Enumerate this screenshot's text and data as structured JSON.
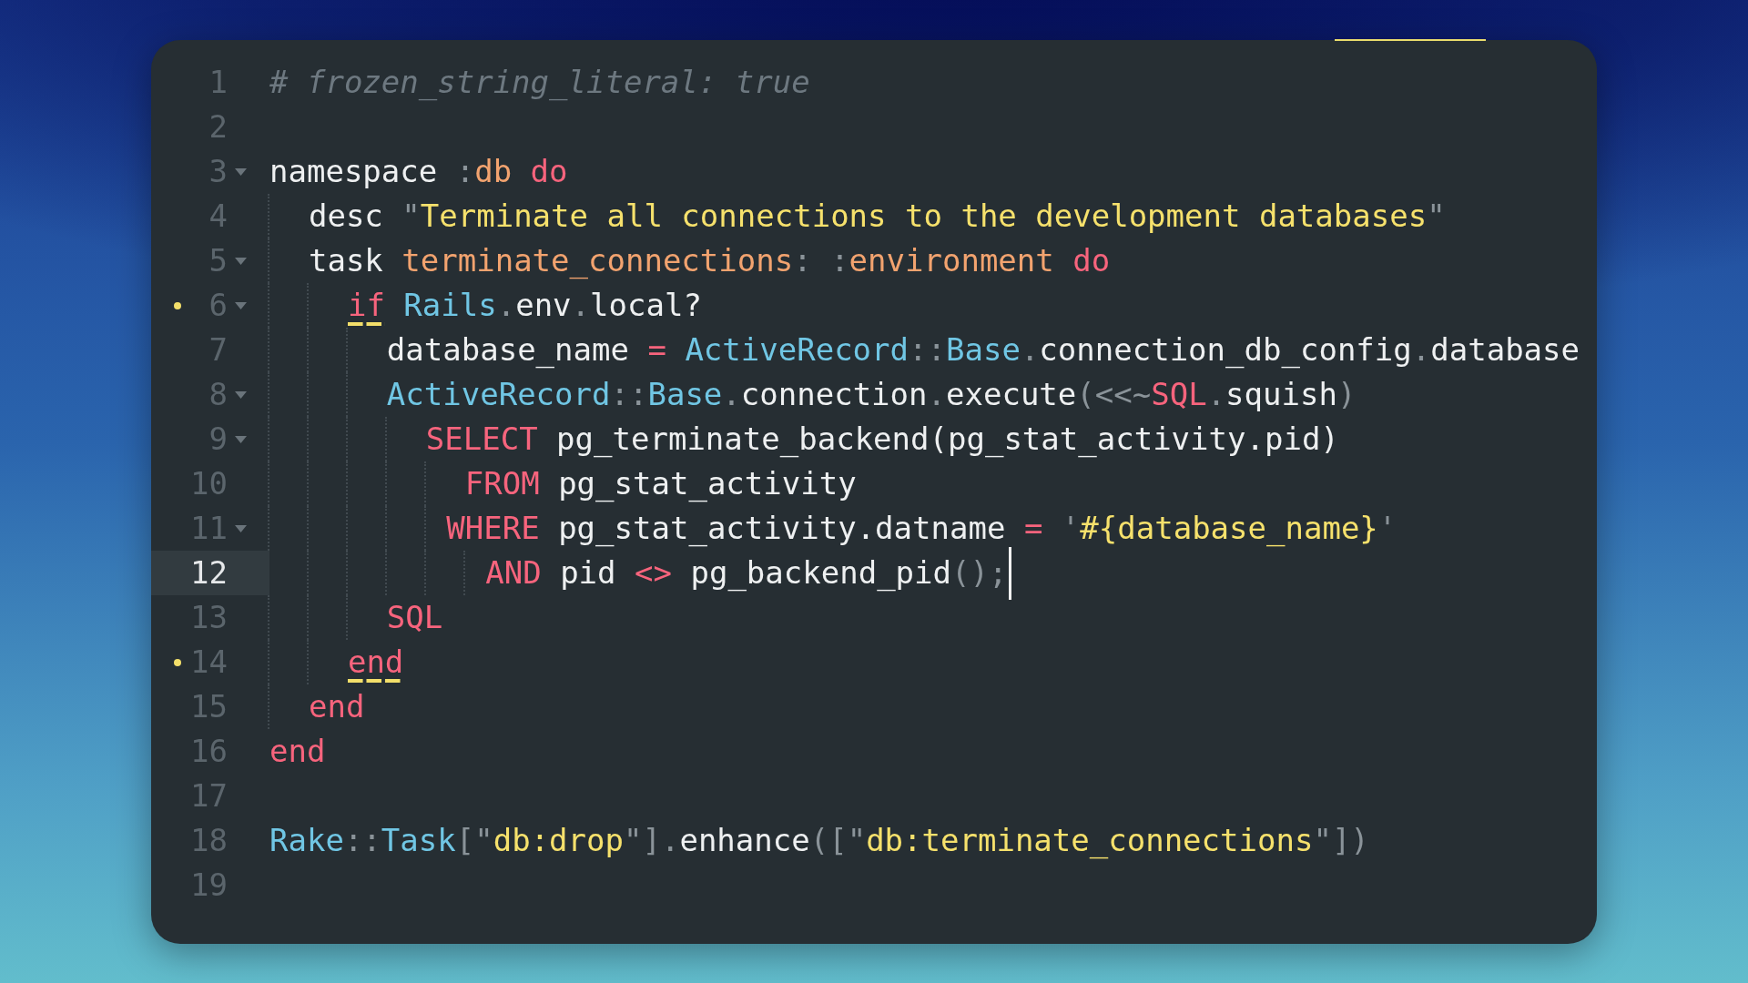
{
  "editor": {
    "lines": [
      {
        "number": "1",
        "tokens": [
          {
            "text": "# frozen_string_literal: true",
            "kind": "comment"
          }
        ],
        "foldable": false,
        "matched": false,
        "current": false
      },
      {
        "number": "2",
        "foldable": false,
        "matched": false,
        "current": false
      },
      {
        "number": "3",
        "tokens": [
          {
            "text": "namespace ",
            "kind": "plain"
          },
          {
            "text": ":",
            "kind": "punct"
          },
          {
            "text": "db",
            "kind": "symbol"
          },
          {
            "text": " do",
            "kind": "keyword"
          }
        ],
        "foldable": true,
        "matched": false,
        "current": false
      },
      {
        "number": "4",
        "tokens": [
          {
            "text": "  desc ",
            "kind": "plain"
          },
          {
            "text": "\"",
            "kind": "punct"
          },
          {
            "text": "Terminate all connections to the development databases",
            "kind": "string"
          },
          {
            "text": "\"",
            "kind": "punct"
          }
        ],
        "foldable": false,
        "matched": false,
        "current": false
      },
      {
        "number": "5",
        "tokens": [
          {
            "text": "  task ",
            "kind": "plain"
          },
          {
            "text": "terminate_connections",
            "kind": "symbol"
          },
          {
            "text": ": :",
            "kind": "punct"
          },
          {
            "text": "environment",
            "kind": "symbol"
          },
          {
            "text": " do",
            "kind": "keyword"
          }
        ],
        "foldable": true,
        "matched": false,
        "current": false
      },
      {
        "number": "6",
        "tokens": [
          {
            "text": "    if",
            "kind": "keyword"
          },
          {
            "text": " Rails",
            "kind": "constant"
          },
          {
            "text": ".",
            "kind": "punct"
          },
          {
            "text": "env",
            "kind": "plain"
          },
          {
            "text": ".",
            "kind": "punct"
          },
          {
            "text": "local?",
            "kind": "plain"
          }
        ],
        "foldable": true,
        "matched": true,
        "current": false
      },
      {
        "number": "7",
        "tokens": [
          {
            "text": "      database_name ",
            "kind": "plain"
          },
          {
            "text": "=",
            "kind": "operator"
          },
          {
            "text": " ActiveRecord",
            "kind": "constant"
          },
          {
            "text": "::",
            "kind": "punct"
          },
          {
            "text": "Base",
            "kind": "constant"
          },
          {
            "text": ".",
            "kind": "punct"
          },
          {
            "text": "connection_db_config",
            "kind": "plain"
          },
          {
            "text": ".",
            "kind": "punct"
          },
          {
            "text": "database",
            "kind": "plain"
          }
        ],
        "foldable": false,
        "matched": false,
        "current": false
      },
      {
        "number": "8",
        "tokens": [
          {
            "text": "      ActiveRecord",
            "kind": "constant"
          },
          {
            "text": "::",
            "kind": "punct"
          },
          {
            "text": "Base",
            "kind": "constant"
          },
          {
            "text": ".",
            "kind": "punct"
          },
          {
            "text": "connection",
            "kind": "plain"
          },
          {
            "text": ".",
            "kind": "punct"
          },
          {
            "text": "execute",
            "kind": "plain"
          },
          {
            "text": "(<<~",
            "kind": "punct"
          },
          {
            "text": "SQL",
            "kind": "keyword"
          },
          {
            "text": ".",
            "kind": "punct"
          },
          {
            "text": "squish",
            "kind": "plain"
          },
          {
            "text": ")",
            "kind": "punct"
          }
        ],
        "foldable": true,
        "matched": false,
        "current": false
      },
      {
        "number": "9",
        "tokens": [
          {
            "text": "        SELECT",
            "kind": "keyword"
          },
          {
            "text": " pg_terminate_backend(pg_stat_activity.pid)",
            "kind": "plain"
          }
        ],
        "foldable": true,
        "matched": false,
        "current": false
      },
      {
        "number": "10",
        "tokens": [
          {
            "text": "          FROM",
            "kind": "keyword"
          },
          {
            "text": " pg_stat_activity",
            "kind": "plain"
          }
        ],
        "foldable": false,
        "matched": false,
        "current": false
      },
      {
        "number": "11",
        "tokens": [
          {
            "text": "         WHERE",
            "kind": "keyword"
          },
          {
            "text": " pg_stat_activity.datname ",
            "kind": "plain"
          },
          {
            "text": "=",
            "kind": "operator"
          },
          {
            "text": " '",
            "kind": "punct"
          },
          {
            "text": "#{database_name}",
            "kind": "string"
          },
          {
            "text": "'",
            "kind": "punct"
          }
        ],
        "foldable": true,
        "matched": false,
        "current": false
      },
      {
        "number": "12",
        "tokens": [
          {
            "text": "           AND",
            "kind": "keyword"
          },
          {
            "text": " pid ",
            "kind": "plain"
          },
          {
            "text": "<>",
            "kind": "operator"
          },
          {
            "text": " pg_backend_pid",
            "kind": "plain"
          },
          {
            "text": "();",
            "kind": "punct"
          }
        ],
        "foldable": false,
        "matched": false,
        "current": true
      },
      {
        "number": "13",
        "tokens": [
          {
            "text": "      SQL",
            "kind": "keyword"
          }
        ],
        "foldable": false,
        "matched": false,
        "current": false
      },
      {
        "number": "14",
        "tokens": [
          {
            "text": "    end",
            "kind": "keyword"
          }
        ],
        "foldable": false,
        "matched": true,
        "current": false
      },
      {
        "number": "15",
        "tokens": [
          {
            "text": "  end",
            "kind": "keyword"
          }
        ],
        "foldable": false,
        "matched": false,
        "current": false
      },
      {
        "number": "16",
        "tokens": [
          {
            "text": "end",
            "kind": "keyword"
          }
        ],
        "foldable": false,
        "matched": false,
        "current": false
      },
      {
        "number": "17",
        "foldable": false,
        "matched": false,
        "current": false
      },
      {
        "number": "18",
        "tokens": [
          {
            "text": "Rake",
            "kind": "constant"
          },
          {
            "text": "::",
            "kind": "punct"
          },
          {
            "text": "Task",
            "kind": "constant"
          },
          {
            "text": "[\"",
            "kind": "punct"
          },
          {
            "text": "db:drop",
            "kind": "string"
          },
          {
            "text": "\"].",
            "kind": "punct"
          },
          {
            "text": "enhance",
            "kind": "plain"
          },
          {
            "text": "([\"",
            "kind": "punct"
          },
          {
            "text": "db:terminate_connections",
            "kind": "string"
          },
          {
            "text": "\"])",
            "kind": "punct"
          }
        ],
        "foldable": false,
        "matched": false,
        "current": false
      },
      {
        "number": "19",
        "foldable": false,
        "matched": false,
        "current": false
      }
    ]
  }
}
